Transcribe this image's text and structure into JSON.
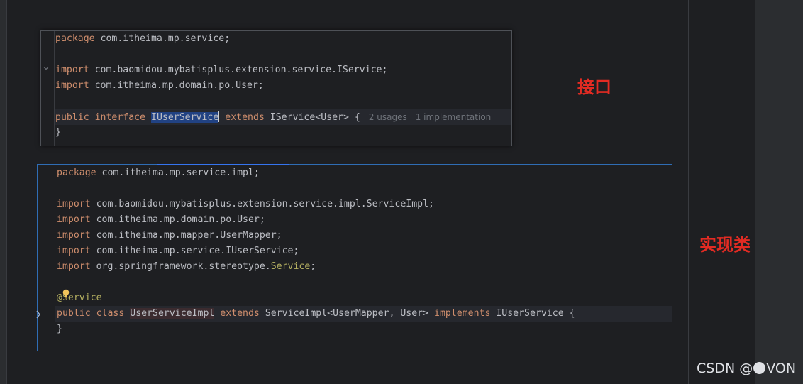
{
  "labels": {
    "interface": "接口",
    "impl": "实现类"
  },
  "interface_file": {
    "package": [
      "package",
      " com.itheima.mp.service;"
    ],
    "import1": [
      "import",
      " com.baomidou.mybatisplus.extension.service.IService;"
    ],
    "import2": [
      "import",
      " com.itheima.mp.domain.po.User;"
    ],
    "decl": {
      "kw_public": "public",
      "kw_interface": "interface",
      "name": "IUserService",
      "kw_extends": "extends",
      "rest": " IService<User> {",
      "usages_hint": "2 usages",
      "impl_hint": "1 implementation"
    },
    "close": "}"
  },
  "impl_file": {
    "package": [
      "package",
      " com.itheima.mp.service.impl;"
    ],
    "imports": [
      [
        "import",
        " com.baomidou.mybatisplus.extension.service.impl.ServiceImpl;"
      ],
      [
        "import",
        " com.itheima.mp.domain.po.User;"
      ],
      [
        "import",
        " com.itheima.mp.mapper.UserMapper;"
      ],
      [
        "import",
        " com.itheima.mp.service.IUserService;"
      ]
    ],
    "import5": {
      "kw": "import",
      "path": " org.springframework.stereotype.",
      "ann": "Service",
      "semi": ";"
    },
    "annotation": "@Service",
    "decl": {
      "kw_public": "public",
      "kw_class": "class",
      "name": "UserServiceImpl",
      "kw_extends": "extends",
      "mid": " ServiceImpl<UserMapper, User> ",
      "kw_implements": "implements",
      "rest": " IUserService {"
    },
    "close": "}"
  },
  "watermark": {
    "before": "CSDN @",
    "after": "VON"
  },
  "colors": {
    "label_red": "#e32b23",
    "keyword": "#cf8e6d",
    "annotation": "#b3ae60",
    "selection": "#214283",
    "focus_border": "#2f6db5"
  },
  "icons": {
    "fold": "chevron-down-icon",
    "bulb": "lightbulb-icon",
    "marker": "implementation-marker-icon"
  }
}
